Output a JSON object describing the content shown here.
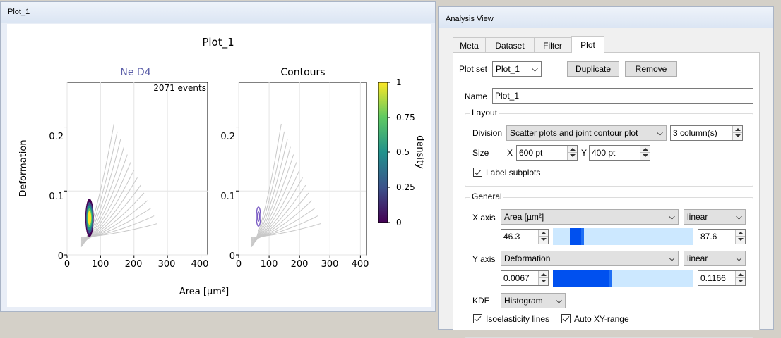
{
  "plot_window": {
    "title": "Plot_1",
    "figure_title": "Plot_1",
    "scatter_title": "Ne D4",
    "contour_title": "Contours",
    "events_label": "2071 events",
    "xlabel": "Area [µm²]",
    "ylabel": "Deformation",
    "colorbar_label": "density",
    "x_ticks": [
      "0",
      "100",
      "200",
      "300",
      "400"
    ],
    "y_ticks": [
      "0",
      "0.1",
      "0.2"
    ],
    "colorbar_ticks": [
      "0",
      "0.25",
      "0.5",
      "0.75",
      "1"
    ],
    "colors": {
      "title_accent": "#5b5ea8",
      "contour": "#7b5dc4",
      "isoelastic": "#c8c8c8"
    }
  },
  "chart_data": [
    {
      "type": "scatter",
      "title": "Ne D4",
      "xlabel": "Area [µm²]",
      "ylabel": "Deformation",
      "xlim": [
        0,
        420
      ],
      "ylim": [
        0,
        0.27
      ],
      "x_ticks": [
        0,
        100,
        200,
        300,
        400
      ],
      "y_ticks": [
        0,
        0.1,
        0.2
      ],
      "annotation": "2071 events",
      "grid": true,
      "density_cluster": {
        "x_center": 67,
        "y_center": 0.058,
        "x_range": [
          55,
          80
        ],
        "y_range": [
          0.035,
          0.095
        ]
      },
      "colormap": "viridis"
    },
    {
      "type": "scatter",
      "title": "Contours",
      "xlabel": "Area [µm²]",
      "xlim": [
        0,
        420
      ],
      "ylim": [
        0,
        0.27
      ],
      "x_ticks": [
        0,
        100,
        200,
        300,
        400
      ],
      "y_ticks": [
        0,
        0.1,
        0.2
      ],
      "grid": true,
      "contour_region": {
        "x_range": [
          58,
          72
        ],
        "y_range": [
          0.045,
          0.075
        ]
      }
    }
  ],
  "analysis": {
    "title": "Analysis View",
    "tabs": [
      "Meta",
      "Dataset",
      "Filter",
      "Plot"
    ],
    "active_tab": "Plot",
    "plot_set_label": "Plot set",
    "plot_set_value": "Plot_1",
    "duplicate_label": "Duplicate",
    "remove_label": "Remove",
    "name_label": "Name",
    "name_value": "Plot_1",
    "layout": {
      "title": "Layout",
      "division_label": "Division",
      "division_value": "Scatter plots and joint contour plot",
      "columns_value": "3 column(s)",
      "size_label": "Size",
      "x_label": "X",
      "x_value": "600 pt",
      "y_label": "Y",
      "y_value": "400 pt",
      "label_subplots": "Label subplots"
    },
    "general": {
      "title": "General",
      "xaxis_label": "X axis",
      "xaxis_value": "Area [µm²]",
      "xaxis_scale": "linear",
      "x_min": "46.3",
      "x_max": "87.6",
      "x_range_fraction": [
        0.12,
        0.22
      ],
      "yaxis_label": "Y axis",
      "yaxis_value": "Deformation",
      "yaxis_scale": "linear",
      "y_min": "0.0067",
      "y_max": "0.1166",
      "y_range_fraction": [
        0.0,
        0.42
      ],
      "kde_label": "KDE",
      "kde_value": "Histogram",
      "isoelasticity_label": "Isoelasticity lines",
      "auto_range_label": "Auto XY-range"
    }
  }
}
